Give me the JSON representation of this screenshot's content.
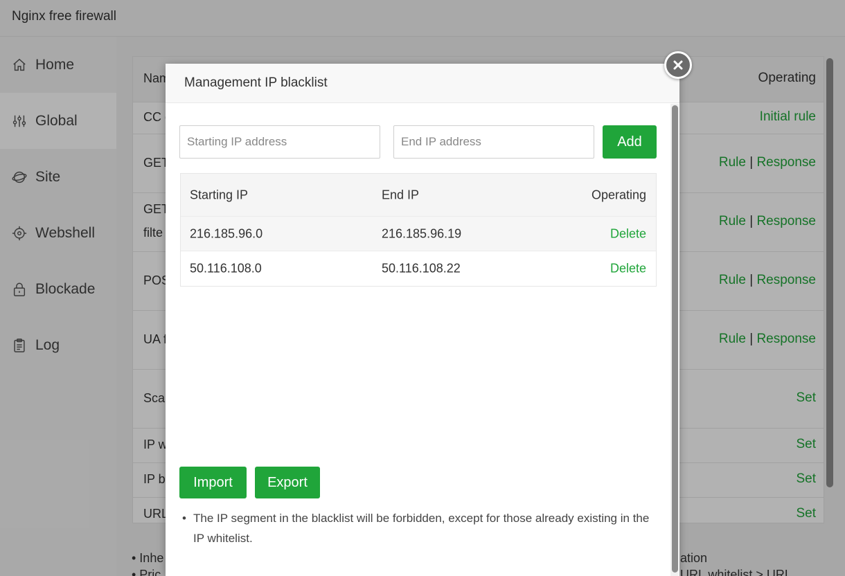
{
  "app": {
    "title": "Nginx free firewall"
  },
  "sidebar": {
    "items": [
      {
        "label": "Home",
        "icon": "home-icon"
      },
      {
        "label": "Global",
        "icon": "sliders-icon"
      },
      {
        "label": "Site",
        "icon": "globe-icon"
      },
      {
        "label": "Webshell",
        "icon": "target-icon"
      },
      {
        "label": "Blockade",
        "icon": "lock-icon"
      },
      {
        "label": "Log",
        "icon": "clipboard-icon"
      }
    ]
  },
  "panel": {
    "header": {
      "name": "Nam",
      "operating": "Operating"
    },
    "rows": [
      {
        "name": "CC d",
        "op1": "Initial rule"
      },
      {
        "name": "GET",
        "op1": "Rule",
        "sep": "|",
        "op2": "Response"
      },
      {
        "name": "GET",
        "name2": "filte",
        "op1": "Rule",
        "sep": "|",
        "op2": "Response"
      },
      {
        "name": "POS",
        "op1": "Rule",
        "sep": "|",
        "op2": "Response"
      },
      {
        "name": "UA f",
        "op1": "Rule",
        "sep": "|",
        "op2": "Response"
      },
      {
        "name": "Scar",
        "op1": "Set"
      },
      {
        "name": "IP w",
        "op1": "Set"
      },
      {
        "name": "IP b",
        "op1": "Set"
      },
      {
        "name": "URL",
        "op1": "Set"
      }
    ],
    "notes_left": [
      "•  Inhe",
      "•  Pric"
    ],
    "notes_right": [
      "ation",
      "URL whitelist > URL"
    ]
  },
  "modal": {
    "title": "Management IP blacklist",
    "start_placeholder": "Starting IP address",
    "end_placeholder": "End IP address",
    "add_label": "Add",
    "table": {
      "headers": [
        "Starting IP",
        "End IP",
        "Operating"
      ],
      "rows": [
        {
          "start": "216.185.96.0",
          "end": "216.185.96.19",
          "action": "Delete"
        },
        {
          "start": "50.116.108.0",
          "end": "50.116.108.22",
          "action": "Delete"
        }
      ]
    },
    "import_label": "Import",
    "export_label": "Export",
    "note": "The IP segment in the blacklist will be forbidden, except for those already existing in the IP whitelist.",
    "note_bullet": "•"
  },
  "colors": {
    "accent": "#20a53a",
    "link_visited": "#2a5aa8"
  }
}
